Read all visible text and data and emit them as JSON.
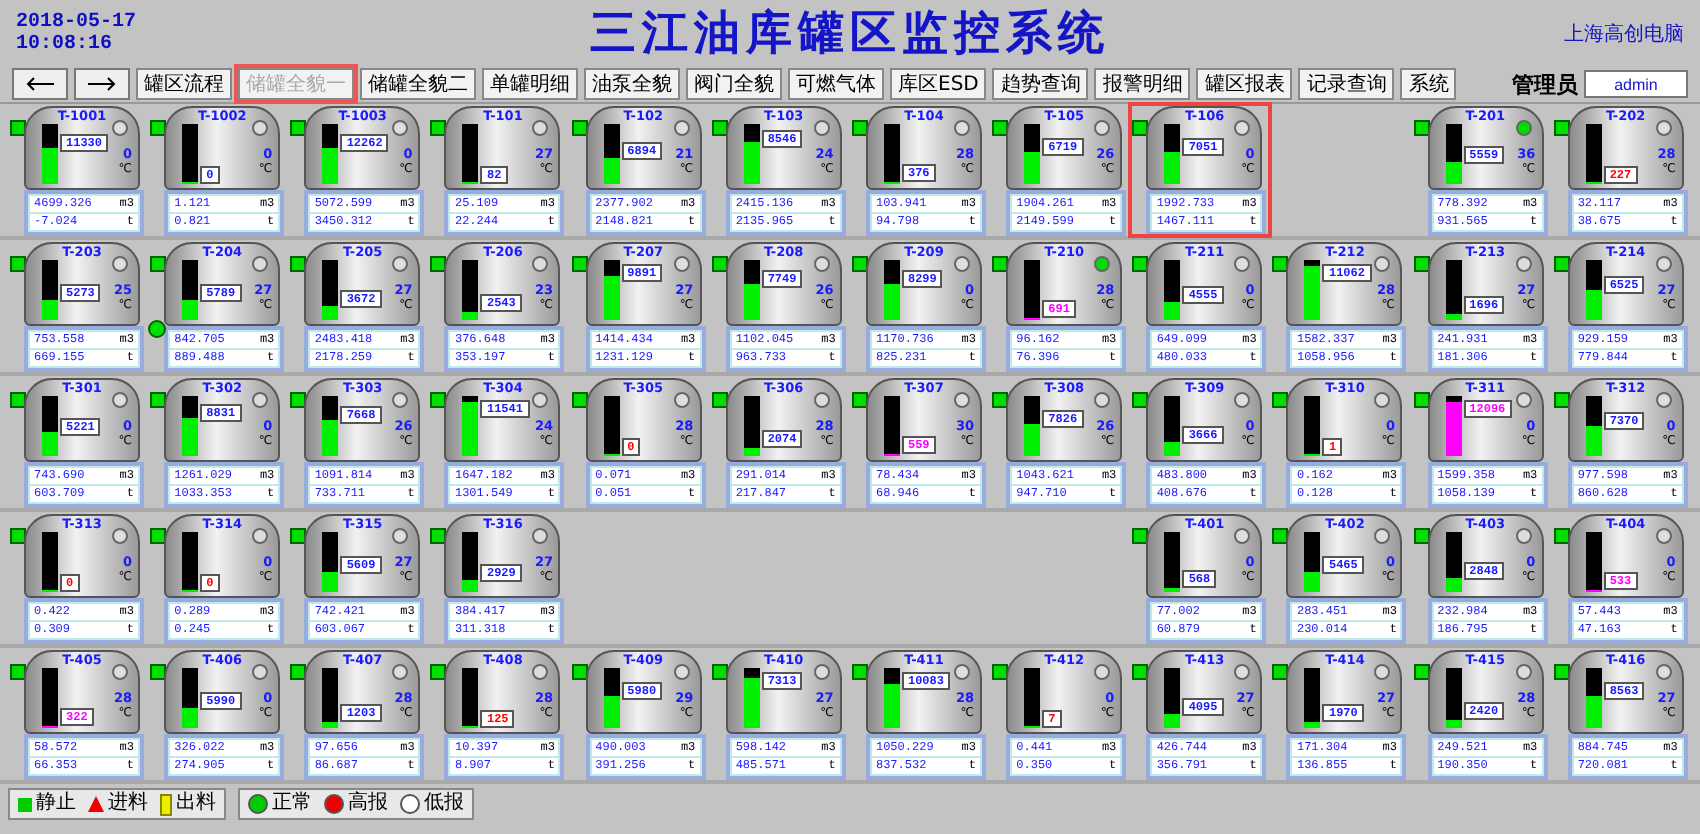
{
  "header": {
    "date": "2018-05-17",
    "time": "10:08:16",
    "title": "三江油库罐区监控系统",
    "company": "上海高创电脑"
  },
  "nav": {
    "menu": [
      {
        "label": "罐区流程",
        "selected": false
      },
      {
        "label": "储罐全貌一",
        "selected": true
      },
      {
        "label": "储罐全貌二",
        "selected": false
      },
      {
        "label": "单罐明细",
        "selected": false
      },
      {
        "label": "油泵全貌",
        "selected": false
      },
      {
        "label": "阀门全貌",
        "selected": false
      },
      {
        "label": "可燃气体",
        "selected": false
      },
      {
        "label": "库区ESD",
        "selected": false
      },
      {
        "label": "趋势查询",
        "selected": false
      },
      {
        "label": "报警明细",
        "selected": false
      },
      {
        "label": "罐区报表",
        "selected": false
      },
      {
        "label": "记录查询",
        "selected": false
      },
      {
        "label": "系统",
        "selected": false
      }
    ],
    "user_label": "管理员",
    "user": "admin"
  },
  "rows": [
    {
      "cells": [
        {
          "kind": "tank",
          "name": "T-1001",
          "level": 0.6,
          "reading": "11330",
          "color": "#1a1aff",
          "temp": "0",
          "temp_unit": "℃",
          "volume": "4699.326",
          "volume_unit": "m3",
          "weight": "-7.024",
          "weight_unit": "t",
          "lamp_on": false,
          "side_lamp": false,
          "highlighted": false
        },
        {
          "kind": "tank",
          "name": "T-1002",
          "level": 0,
          "reading": "0",
          "color": "#1a1aff",
          "temp": "0",
          "temp_unit": "℃",
          "volume": "1.121",
          "volume_unit": "m3",
          "weight": "0.821",
          "weight_unit": "t",
          "lamp_on": false,
          "side_lamp": false,
          "highlighted": false
        },
        {
          "kind": "tank",
          "name": "T-1003",
          "level": 0.6,
          "reading": "12262",
          "color": "#1a1aff",
          "temp": "0",
          "temp_unit": "℃",
          "volume": "5072.599",
          "volume_unit": "m3",
          "weight": "3450.312",
          "weight_unit": "t",
          "lamp_on": false,
          "side_lamp": false,
          "highlighted": false
        },
        {
          "kind": "tank",
          "name": "T-101",
          "level": 0,
          "reading": "82",
          "color": "#1a1aff",
          "temp": "27",
          "temp_unit": "℃",
          "volume": "25.109",
          "volume_unit": "m3",
          "weight": "22.244",
          "weight_unit": "t",
          "lamp_on": false,
          "side_lamp": false,
          "highlighted": false
        },
        {
          "kind": "tank",
          "name": "T-102",
          "level": 0.45,
          "reading": "6894",
          "color": "#1a1aff",
          "temp": "21",
          "temp_unit": "℃",
          "volume": "2377.902",
          "volume_unit": "m3",
          "weight": "2148.821",
          "weight_unit": "t",
          "lamp_on": false,
          "side_lamp": false,
          "highlighted": false
        },
        {
          "kind": "tank",
          "name": "T-103",
          "level": 0.7,
          "reading": "8546",
          "color": "#1a1aff",
          "temp": "24",
          "temp_unit": "℃",
          "volume": "2415.136",
          "volume_unit": "m3",
          "weight": "2135.965",
          "weight_unit": "t",
          "lamp_on": false,
          "side_lamp": false,
          "highlighted": false
        },
        {
          "kind": "tank",
          "name": "T-104",
          "level": 0.03,
          "reading": "376",
          "color": "#1a1aff",
          "temp": "28",
          "temp_unit": "℃",
          "volume": "103.941",
          "volume_unit": "m3",
          "weight": "94.798",
          "weight_unit": "t",
          "lamp_on": false,
          "side_lamp": false,
          "highlighted": false
        },
        {
          "kind": "tank",
          "name": "T-105",
          "level": 0.55,
          "reading": "6719",
          "color": "#1a1aff",
          "temp": "26",
          "temp_unit": "℃",
          "volume": "1904.261",
          "volume_unit": "m3",
          "weight": "2149.599",
          "weight_unit": "t",
          "lamp_on": false,
          "side_lamp": false,
          "highlighted": false
        },
        {
          "kind": "tank",
          "name": "T-106",
          "level": 0.55,
          "reading": "7051",
          "color": "#1a1aff",
          "temp": "0",
          "temp_unit": "℃",
          "volume": "1992.733",
          "volume_unit": "m3",
          "weight": "1467.111",
          "weight_unit": "t",
          "lamp_on": false,
          "side_lamp": false,
          "highlighted": true
        },
        {
          "kind": "empty"
        },
        {
          "kind": "tank",
          "name": "T-201",
          "level": 0.38,
          "reading": "5559",
          "color": "#1a1aff",
          "temp": "36",
          "temp_unit": "℃",
          "volume": "778.392",
          "volume_unit": "m3",
          "weight": "931.565",
          "weight_unit": "t",
          "lamp_on": true,
          "side_lamp": false,
          "highlighted": false
        },
        {
          "kind": "tank",
          "name": "T-202",
          "level": 0,
          "reading": "227",
          "color": "#ff0000",
          "temp": "28",
          "temp_unit": "℃",
          "volume": "32.117",
          "volume_unit": "m3",
          "weight": "38.675",
          "weight_unit": "t",
          "lamp_on": false,
          "side_lamp": false,
          "highlighted": false
        }
      ]
    },
    {
      "cells": [
        {
          "kind": "tank",
          "name": "T-203",
          "level": 0.35,
          "reading": "5273",
          "color": "#1a1aff",
          "temp": "25",
          "temp_unit": "℃",
          "volume": "753.558",
          "volume_unit": "m3",
          "weight": "669.155",
          "weight_unit": "t",
          "lamp_on": false,
          "side_lamp": false,
          "highlighted": false
        },
        {
          "kind": "tank",
          "name": "T-204",
          "level": 0.35,
          "reading": "5789",
          "color": "#1a1aff",
          "temp": "27",
          "temp_unit": "℃",
          "volume": "842.705",
          "volume_unit": "m3",
          "weight": "889.488",
          "weight_unit": "t",
          "lamp_on": false,
          "side_lamp": true,
          "highlighted": false
        },
        {
          "kind": "tank",
          "name": "T-205",
          "level": 0.25,
          "reading": "3672",
          "color": "#1a1aff",
          "temp": "27",
          "temp_unit": "℃",
          "volume": "2483.418",
          "volume_unit": "m3",
          "weight": "2178.259",
          "weight_unit": "t",
          "lamp_on": false,
          "side_lamp": false,
          "highlighted": false
        },
        {
          "kind": "tank",
          "name": "T-206",
          "level": 0.15,
          "reading": "2543",
          "color": "#1a1aff",
          "temp": "23",
          "temp_unit": "℃",
          "volume": "376.648",
          "volume_unit": "m3",
          "weight": "353.197",
          "weight_unit": "t",
          "lamp_on": false,
          "side_lamp": false,
          "highlighted": false
        },
        {
          "kind": "tank",
          "name": "T-207",
          "level": 0.75,
          "reading": "9891",
          "color": "#1a1aff",
          "temp": "27",
          "temp_unit": "℃",
          "volume": "1414.434",
          "volume_unit": "m3",
          "weight": "1231.129",
          "weight_unit": "t",
          "lamp_on": false,
          "side_lamp": false,
          "highlighted": false
        },
        {
          "kind": "tank",
          "name": "T-208",
          "level": 0.6,
          "reading": "7749",
          "color": "#1a1aff",
          "temp": "26",
          "temp_unit": "℃",
          "volume": "1102.045",
          "volume_unit": "m3",
          "weight": "963.733",
          "weight_unit": "t",
          "lamp_on": false,
          "side_lamp": false,
          "highlighted": false
        },
        {
          "kind": "tank",
          "name": "T-209",
          "level": 0.6,
          "reading": "8299",
          "color": "#1a1aff",
          "temp": "0",
          "temp_unit": "℃",
          "volume": "1170.736",
          "volume_unit": "m3",
          "weight": "825.231",
          "weight_unit": "t",
          "lamp_on": false,
          "side_lamp": false,
          "highlighted": false
        },
        {
          "kind": "tank",
          "name": "T-210",
          "level": 0.03,
          "reading": "691",
          "color": "#ff00ff",
          "temp": "28",
          "temp_unit": "℃",
          "volume": "96.162",
          "volume_unit": "m3",
          "weight": "76.396",
          "weight_unit": "t",
          "lamp_on": true,
          "side_lamp": false,
          "highlighted": false
        },
        {
          "kind": "tank",
          "name": "T-211",
          "level": 0.3,
          "reading": "4555",
          "color": "#1a1aff",
          "temp": "0",
          "temp_unit": "℃",
          "volume": "649.099",
          "volume_unit": "m3",
          "weight": "480.033",
          "weight_unit": "t",
          "lamp_on": false,
          "side_lamp": false,
          "highlighted": false
        },
        {
          "kind": "tank",
          "name": "T-212",
          "level": 0.9,
          "reading": "11062",
          "color": "#1a1aff",
          "temp": "28",
          "temp_unit": "℃",
          "volume": "1582.337",
          "volume_unit": "m3",
          "weight": "1058.956",
          "weight_unit": "t",
          "lamp_on": false,
          "side_lamp": false,
          "highlighted": false
        },
        {
          "kind": "tank",
          "name": "T-213",
          "level": 0.1,
          "reading": "1696",
          "color": "#1a1aff",
          "temp": "27",
          "temp_unit": "℃",
          "volume": "241.931",
          "volume_unit": "m3",
          "weight": "181.306",
          "weight_unit": "t",
          "lamp_on": false,
          "side_lamp": false,
          "highlighted": false
        },
        {
          "kind": "tank",
          "name": "T-214",
          "level": 0.5,
          "reading": "6525",
          "color": "#1a1aff",
          "temp": "27",
          "temp_unit": "℃",
          "volume": "929.159",
          "volume_unit": "m3",
          "weight": "779.844",
          "weight_unit": "t",
          "lamp_on": false,
          "side_lamp": false,
          "highlighted": false
        }
      ]
    },
    {
      "cells": [
        {
          "kind": "tank",
          "name": "T-301",
          "level": 0.4,
          "reading": "5221",
          "color": "#1a1aff",
          "temp": "0",
          "temp_unit": "℃",
          "volume": "743.690",
          "volume_unit": "m3",
          "weight": "603.709",
          "weight_unit": "t",
          "lamp_on": false,
          "side_lamp": false,
          "highlighted": false
        },
        {
          "kind": "tank",
          "name": "T-302",
          "level": 0.65,
          "reading": "8831",
          "color": "#1a1aff",
          "temp": "0",
          "temp_unit": "℃",
          "volume": "1261.029",
          "volume_unit": "m3",
          "weight": "1033.353",
          "weight_unit": "t",
          "lamp_on": false,
          "side_lamp": false,
          "highlighted": false
        },
        {
          "kind": "tank",
          "name": "T-303",
          "level": 0.6,
          "reading": "7668",
          "color": "#1a1aff",
          "temp": "26",
          "temp_unit": "℃",
          "volume": "1091.814",
          "volume_unit": "m3",
          "weight": "733.711",
          "weight_unit": "t",
          "lamp_on": false,
          "side_lamp": false,
          "highlighted": false
        },
        {
          "kind": "tank",
          "name": "T-304",
          "level": 0.9,
          "reading": "11541",
          "color": "#1a1aff",
          "temp": "24",
          "temp_unit": "℃",
          "volume": "1647.182",
          "volume_unit": "m3",
          "weight": "1301.549",
          "weight_unit": "t",
          "lamp_on": false,
          "side_lamp": false,
          "highlighted": false
        },
        {
          "kind": "tank",
          "name": "T-305",
          "level": 0,
          "reading": "0",
          "color": "#ff0000",
          "temp": "28",
          "temp_unit": "℃",
          "volume": "0.071",
          "volume_unit": "m3",
          "weight": "0.051",
          "weight_unit": "t",
          "lamp_on": false,
          "side_lamp": false,
          "highlighted": false
        },
        {
          "kind": "tank",
          "name": "T-306",
          "level": 0.15,
          "reading": "2074",
          "color": "#1a1aff",
          "temp": "28",
          "temp_unit": "℃",
          "volume": "291.014",
          "volume_unit": "m3",
          "weight": "217.847",
          "weight_unit": "t",
          "lamp_on": false,
          "side_lamp": false,
          "highlighted": false
        },
        {
          "kind": "tank",
          "name": "T-307",
          "level": 0.03,
          "reading": "559",
          "color": "#ff00ff",
          "temp": "30",
          "temp_unit": "℃",
          "volume": "78.434",
          "volume_unit": "m3",
          "weight": "68.946",
          "weight_unit": "t",
          "lamp_on": false,
          "side_lamp": false,
          "highlighted": false
        },
        {
          "kind": "tank",
          "name": "T-308",
          "level": 0.55,
          "reading": "7826",
          "color": "#1a1aff",
          "temp": "26",
          "temp_unit": "℃",
          "volume": "1043.621",
          "volume_unit": "m3",
          "weight": "947.710",
          "weight_unit": "t",
          "lamp_on": false,
          "side_lamp": false,
          "highlighted": false
        },
        {
          "kind": "tank",
          "name": "T-309",
          "level": 0.25,
          "reading": "3666",
          "color": "#1a1aff",
          "temp": "0",
          "temp_unit": "℃",
          "volume": "483.800",
          "volume_unit": "m3",
          "weight": "408.676",
          "weight_unit": "t",
          "lamp_on": false,
          "side_lamp": false,
          "highlighted": false
        },
        {
          "kind": "tank",
          "name": "T-310",
          "level": 0,
          "reading": "1",
          "color": "#ff0000",
          "temp": "0",
          "temp_unit": "℃",
          "volume": "0.162",
          "volume_unit": "m3",
          "weight": "0.128",
          "weight_unit": "t",
          "lamp_on": false,
          "side_lamp": false,
          "highlighted": false
        },
        {
          "kind": "tank",
          "name": "T-311",
          "level": 0.9,
          "reading": "12096",
          "color": "#ff00ff",
          "temp": "0",
          "temp_unit": "℃",
          "volume": "1599.358",
          "volume_unit": "m3",
          "weight": "1058.139",
          "weight_unit": "t",
          "lamp_on": false,
          "side_lamp": false,
          "highlighted": false
        },
        {
          "kind": "tank",
          "name": "T-312",
          "level": 0.5,
          "reading": "7370",
          "color": "#1a1aff",
          "temp": "0",
          "temp_unit": "℃",
          "volume": "977.598",
          "volume_unit": "m3",
          "weight": "860.628",
          "weight_unit": "t",
          "lamp_on": false,
          "side_lamp": false,
          "highlighted": false
        }
      ]
    },
    {
      "cells": [
        {
          "kind": "tank",
          "name": "T-313",
          "level": 0,
          "reading": "0",
          "color": "#ff0000",
          "temp": "0",
          "temp_unit": "℃",
          "volume": "0.422",
          "volume_unit": "m3",
          "weight": "0.309",
          "weight_unit": "t",
          "lamp_on": false,
          "side_lamp": false,
          "highlighted": false
        },
        {
          "kind": "tank",
          "name": "T-314",
          "level": 0,
          "reading": "0",
          "color": "#ff0000",
          "temp": "0",
          "temp_unit": "℃",
          "volume": "0.289",
          "volume_unit": "m3",
          "weight": "0.245",
          "weight_unit": "t",
          "lamp_on": false,
          "side_lamp": false,
          "highlighted": false
        },
        {
          "kind": "tank",
          "name": "T-315",
          "level": 0.35,
          "reading": "5609",
          "color": "#1a1aff",
          "temp": "27",
          "temp_unit": "℃",
          "volume": "742.421",
          "volume_unit": "m3",
          "weight": "603.067",
          "weight_unit": "t",
          "lamp_on": false,
          "side_lamp": false,
          "highlighted": false
        },
        {
          "kind": "tank",
          "name": "T-316",
          "level": 0.2,
          "reading": "2929",
          "color": "#1a1aff",
          "temp": "27",
          "temp_unit": "℃",
          "volume": "384.417",
          "volume_unit": "m3",
          "weight": "311.318",
          "weight_unit": "t",
          "lamp_on": false,
          "side_lamp": false,
          "highlighted": false
        },
        {
          "kind": "empty"
        },
        {
          "kind": "empty"
        },
        {
          "kind": "empty"
        },
        {
          "kind": "empty"
        },
        {
          "kind": "tank",
          "name": "T-401",
          "level": 0.08,
          "reading": "568",
          "color": "#1a1aff",
          "temp": "0",
          "temp_unit": "℃",
          "volume": "77.002",
          "volume_unit": "m3",
          "weight": "60.879",
          "weight_unit": "t",
          "lamp_on": false,
          "side_lamp": false,
          "highlighted": false
        },
        {
          "kind": "tank",
          "name": "T-402",
          "level": 0.35,
          "reading": "5465",
          "color": "#1a1aff",
          "temp": "0",
          "temp_unit": "℃",
          "volume": "283.451",
          "volume_unit": "m3",
          "weight": "230.014",
          "weight_unit": "t",
          "lamp_on": false,
          "side_lamp": false,
          "highlighted": false
        },
        {
          "kind": "tank",
          "name": "T-403",
          "level": 0.25,
          "reading": "2848",
          "color": "#1a1aff",
          "temp": "0",
          "temp_unit": "℃",
          "volume": "232.984",
          "volume_unit": "m3",
          "weight": "186.795",
          "weight_unit": "t",
          "lamp_on": false,
          "side_lamp": false,
          "highlighted": false
        },
        {
          "kind": "tank",
          "name": "T-404",
          "level": 0.03,
          "reading": "533",
          "color": "#ff00ff",
          "temp": "0",
          "temp_unit": "℃",
          "volume": "57.443",
          "volume_unit": "m3",
          "weight": "47.163",
          "weight_unit": "t",
          "lamp_on": false,
          "side_lamp": false,
          "highlighted": false
        }
      ]
    },
    {
      "cells": [
        {
          "kind": "tank",
          "name": "T-405",
          "level": 0.03,
          "reading": "322",
          "color": "#ff00ff",
          "temp": "28",
          "temp_unit": "℃",
          "volume": "58.572",
          "volume_unit": "m3",
          "weight": "66.353",
          "weight_unit": "t",
          "lamp_on": false,
          "side_lamp": false,
          "highlighted": false
        },
        {
          "kind": "tank",
          "name": "T-406",
          "level": 0.35,
          "reading": "5990",
          "color": "#1a1aff",
          "temp": "0",
          "temp_unit": "℃",
          "volume": "326.022",
          "volume_unit": "m3",
          "weight": "274.905",
          "weight_unit": "t",
          "lamp_on": false,
          "side_lamp": false,
          "highlighted": false
        },
        {
          "kind": "tank",
          "name": "T-407",
          "level": 0.1,
          "reading": "1203",
          "color": "#1a1aff",
          "temp": "28",
          "temp_unit": "℃",
          "volume": "97.656",
          "volume_unit": "m3",
          "weight": "86.687",
          "weight_unit": "t",
          "lamp_on": false,
          "side_lamp": false,
          "highlighted": false
        },
        {
          "kind": "tank",
          "name": "T-408",
          "level": 0,
          "reading": "125",
          "color": "#ff0000",
          "temp": "28",
          "temp_unit": "℃",
          "volume": "10.397",
          "volume_unit": "m3",
          "weight": "8.907",
          "weight_unit": "t",
          "lamp_on": false,
          "side_lamp": false,
          "highlighted": false
        },
        {
          "kind": "tank",
          "name": "T-409",
          "level": 0.55,
          "reading": "5980",
          "color": "#1a1aff",
          "temp": "29",
          "temp_unit": "℃",
          "volume": "490.003",
          "volume_unit": "m3",
          "weight": "391.256",
          "weight_unit": "t",
          "lamp_on": false,
          "side_lamp": false,
          "highlighted": false
        },
        {
          "kind": "tank",
          "name": "T-410",
          "level": 0.85,
          "reading": "7313",
          "color": "#1a1aff",
          "temp": "27",
          "temp_unit": "℃",
          "volume": "598.142",
          "volume_unit": "m3",
          "weight": "485.571",
          "weight_unit": "t",
          "lamp_on": false,
          "side_lamp": false,
          "highlighted": false
        },
        {
          "kind": "tank",
          "name": "T-411",
          "level": 0.75,
          "reading": "10083",
          "color": "#1a1aff",
          "temp": "28",
          "temp_unit": "℃",
          "volume": "1050.229",
          "volume_unit": "m3",
          "weight": "837.532",
          "weight_unit": "t",
          "lamp_on": false,
          "side_lamp": false,
          "highlighted": false
        },
        {
          "kind": "tank",
          "name": "T-412",
          "level": 0,
          "reading": "7",
          "color": "#ff0000",
          "temp": "0",
          "temp_unit": "℃",
          "volume": "0.441",
          "volume_unit": "m3",
          "weight": "0.350",
          "weight_unit": "t",
          "lamp_on": false,
          "side_lamp": false,
          "highlighted": false
        },
        {
          "kind": "tank",
          "name": "T-413",
          "level": 0.25,
          "reading": "4095",
          "color": "#1a1aff",
          "temp": "27",
          "temp_unit": "℃",
          "volume": "426.744",
          "volume_unit": "m3",
          "weight": "356.791",
          "weight_unit": "t",
          "lamp_on": false,
          "side_lamp": false,
          "highlighted": false
        },
        {
          "kind": "tank",
          "name": "T-414",
          "level": 0.1,
          "reading": "1970",
          "color": "#1a1aff",
          "temp": "27",
          "temp_unit": "℃",
          "volume": "171.304",
          "volume_unit": "m3",
          "weight": "136.855",
          "weight_unit": "t",
          "lamp_on": false,
          "side_lamp": false,
          "highlighted": false
        },
        {
          "kind": "tank",
          "name": "T-415",
          "level": 0.15,
          "reading": "2420",
          "color": "#1a1aff",
          "temp": "28",
          "temp_unit": "℃",
          "volume": "249.521",
          "volume_unit": "m3",
          "weight": "190.350",
          "weight_unit": "t",
          "lamp_on": false,
          "side_lamp": false,
          "highlighted": false
        },
        {
          "kind": "tank",
          "name": "T-416",
          "level": 0.55,
          "reading": "8563",
          "color": "#1a1aff",
          "temp": "27",
          "temp_unit": "℃",
          "volume": "884.745",
          "volume_unit": "m3",
          "weight": "720.081",
          "weight_unit": "t",
          "lamp_on": false,
          "side_lamp": false,
          "highlighted": false
        }
      ]
    }
  ],
  "legend": [
    {
      "items": [
        {
          "kind": "square",
          "label": "静止"
        },
        {
          "kind": "triangle",
          "label": "进料"
        },
        {
          "kind": "bar",
          "label": "出料"
        }
      ]
    },
    {
      "items": [
        {
          "kind": "green-dot",
          "label": "正常"
        },
        {
          "kind": "red-dot",
          "label": "高报"
        },
        {
          "kind": "grey-dot",
          "label": "低报"
        }
      ]
    }
  ]
}
